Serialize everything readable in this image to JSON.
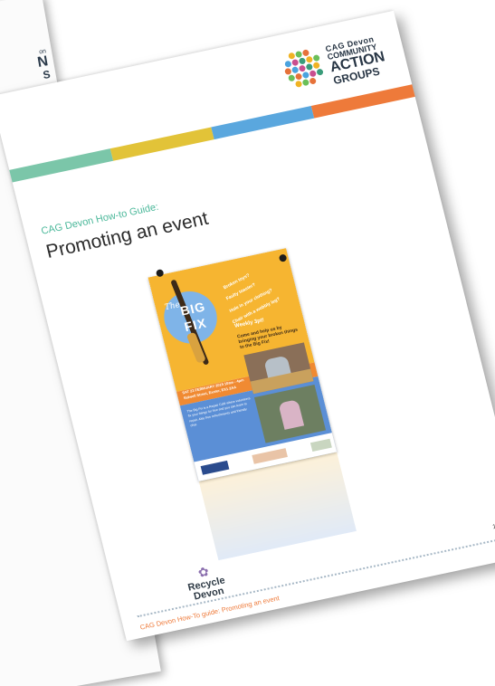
{
  "back_page": {
    "logo_line1": "on",
    "logo_line2": "N",
    "logo_line3": "S",
    "stripe_color": "#ee7a3a"
  },
  "header": {
    "logo": {
      "line1": "CAG Devon",
      "line2": "COMMUNITY",
      "line3": "ACTION",
      "line4": "GROUPS",
      "dot_colors": [
        "#f0b323",
        "#6bbf59",
        "#e6723a",
        "#4aa3df",
        "#c94f8f",
        "#3a9c7a"
      ]
    },
    "stripe_colors": [
      "#7bc6a9",
      "#e2c338",
      "#5aa7de",
      "#ee7a3a"
    ]
  },
  "guide": {
    "kicker": "CAG Devon How-to Guide:",
    "title": "Promoting an event"
  },
  "poster": {
    "the": "The",
    "big": "BIG",
    "fix": "FIX",
    "scribble1": "Broken toys?",
    "scribble2": "Faulty toaster?",
    "scribble3": "Hole in your clothing?",
    "scribble4": "Chair with a wobbly leg?",
    "weekly": "Weekly 3pt!",
    "come_help": "Come and help us by bringing your broken things to the Big Fix!",
    "date": "SAT 23 FEBRUARY 2019 10am - 4pm Sidwell Street, Exeter, EX1 2AA",
    "body": "The Big Fix is a Repair Café where volunteers fix your things for free and you can learn to repair. Also free refreshments and friendly chat.",
    "logos": [
      "Recycle Devon",
      "Repair Cafe",
      "CAG Devon"
    ],
    "colors": {
      "top": "#f6b531",
      "mid": "#f08a32",
      "bottom": "#5b8fd6"
    }
  },
  "footer": {
    "recycle_line1": "Recycle",
    "recycle_line2": "Devon",
    "text": "CAG Devon How-To guide: Promoting an event",
    "page_number": "1",
    "accent": "#ee7a3a"
  }
}
